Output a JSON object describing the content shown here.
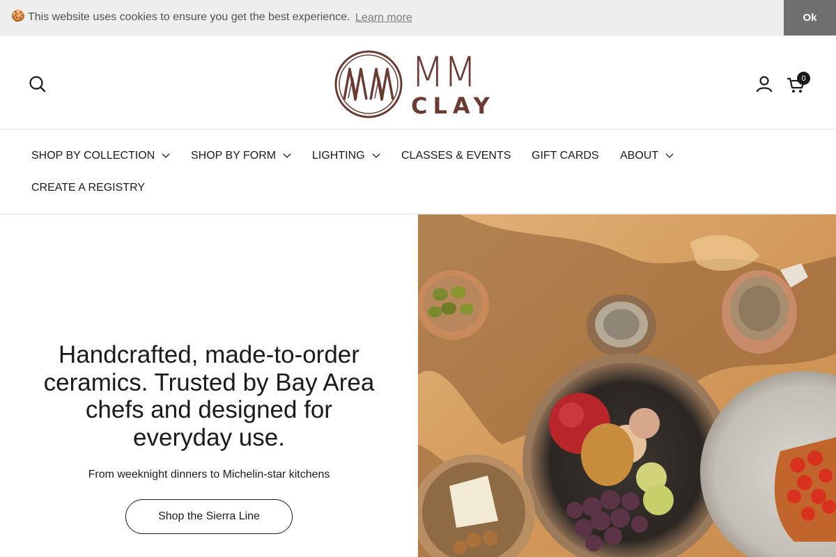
{
  "cookie_bar": {
    "emoji": "🍪",
    "message": "This website uses cookies to ensure you get the best experience.",
    "learn_more": "Learn more",
    "ok": "Ok"
  },
  "header": {
    "logo_mm": "MM",
    "logo_clay": "CLAY",
    "cart_count": "0",
    "icons": [
      "search-icon",
      "account-icon",
      "cart-icon"
    ],
    "brand_color": "#6b3a33"
  },
  "nav": {
    "items": [
      {
        "label": "SHOP BY COLLECTION",
        "has_dropdown": true
      },
      {
        "label": "SHOP BY FORM",
        "has_dropdown": true
      },
      {
        "label": "LIGHTING",
        "has_dropdown": true
      },
      {
        "label": "CLASSES & EVENTS",
        "has_dropdown": false
      },
      {
        "label": "GIFT CARDS",
        "has_dropdown": false
      },
      {
        "label": "ABOUT",
        "has_dropdown": true
      },
      {
        "label": "CREATE A REGISTRY",
        "has_dropdown": false
      }
    ]
  },
  "hero": {
    "title": "Handcrafted, made-to-order ceramics. Trusted by Bay Area chefs and designed for everyday use.",
    "subtitle": "From weeknight dinners to Michelin-star kitchens",
    "cta": "Shop the Sierra Line"
  }
}
